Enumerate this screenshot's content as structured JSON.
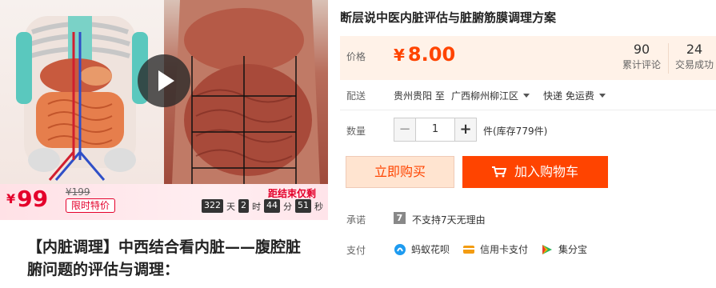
{
  "promo": {
    "price_currency": "¥",
    "price": "99",
    "original_price": "¥199",
    "tag": "限时特价",
    "countdown_title": "距结束仅剩",
    "countdown": {
      "days": "322",
      "days_unit": "天",
      "hours": "2",
      "hours_unit": "时",
      "minutes": "44",
      "minutes_unit": "分",
      "seconds": "51",
      "seconds_unit": "秒"
    }
  },
  "media": {
    "video_play_icon": "play-icon"
  },
  "description": {
    "line1": "【内脏调理】中西结合看内脏——腹腔脏",
    "line2": "腑问题的评估与调理："
  },
  "product": {
    "title": "断层说中医内脏评估与脏腑筋膜调理方案"
  },
  "price": {
    "label": "价格",
    "currency": "¥",
    "value": "8.00",
    "reviews_count": "90",
    "reviews_label": "累计评论",
    "deals_count": "24",
    "deals_label": "交易成功"
  },
  "shipping": {
    "label": "配送",
    "from": "贵州贵阳 至",
    "to": "广西柳州柳江区",
    "method": "快递 免运费"
  },
  "quantity": {
    "label": "数量",
    "minus": "−",
    "value": "1",
    "plus": "+",
    "stock": "件(库存779件)"
  },
  "actions": {
    "buy_now": "立即购买",
    "add_to_cart": "加入购物车"
  },
  "promise": {
    "label": "承诺",
    "icon_text": "7",
    "text": "不支持7天无理由"
  },
  "payment": {
    "label": "支付",
    "methods": [
      "蚂蚁花呗",
      "信用卡支付",
      "集分宝"
    ]
  },
  "colors": {
    "accent": "#ff4400",
    "promo_red": "#e4002b",
    "price_panel_bg": "#fff2e8"
  }
}
